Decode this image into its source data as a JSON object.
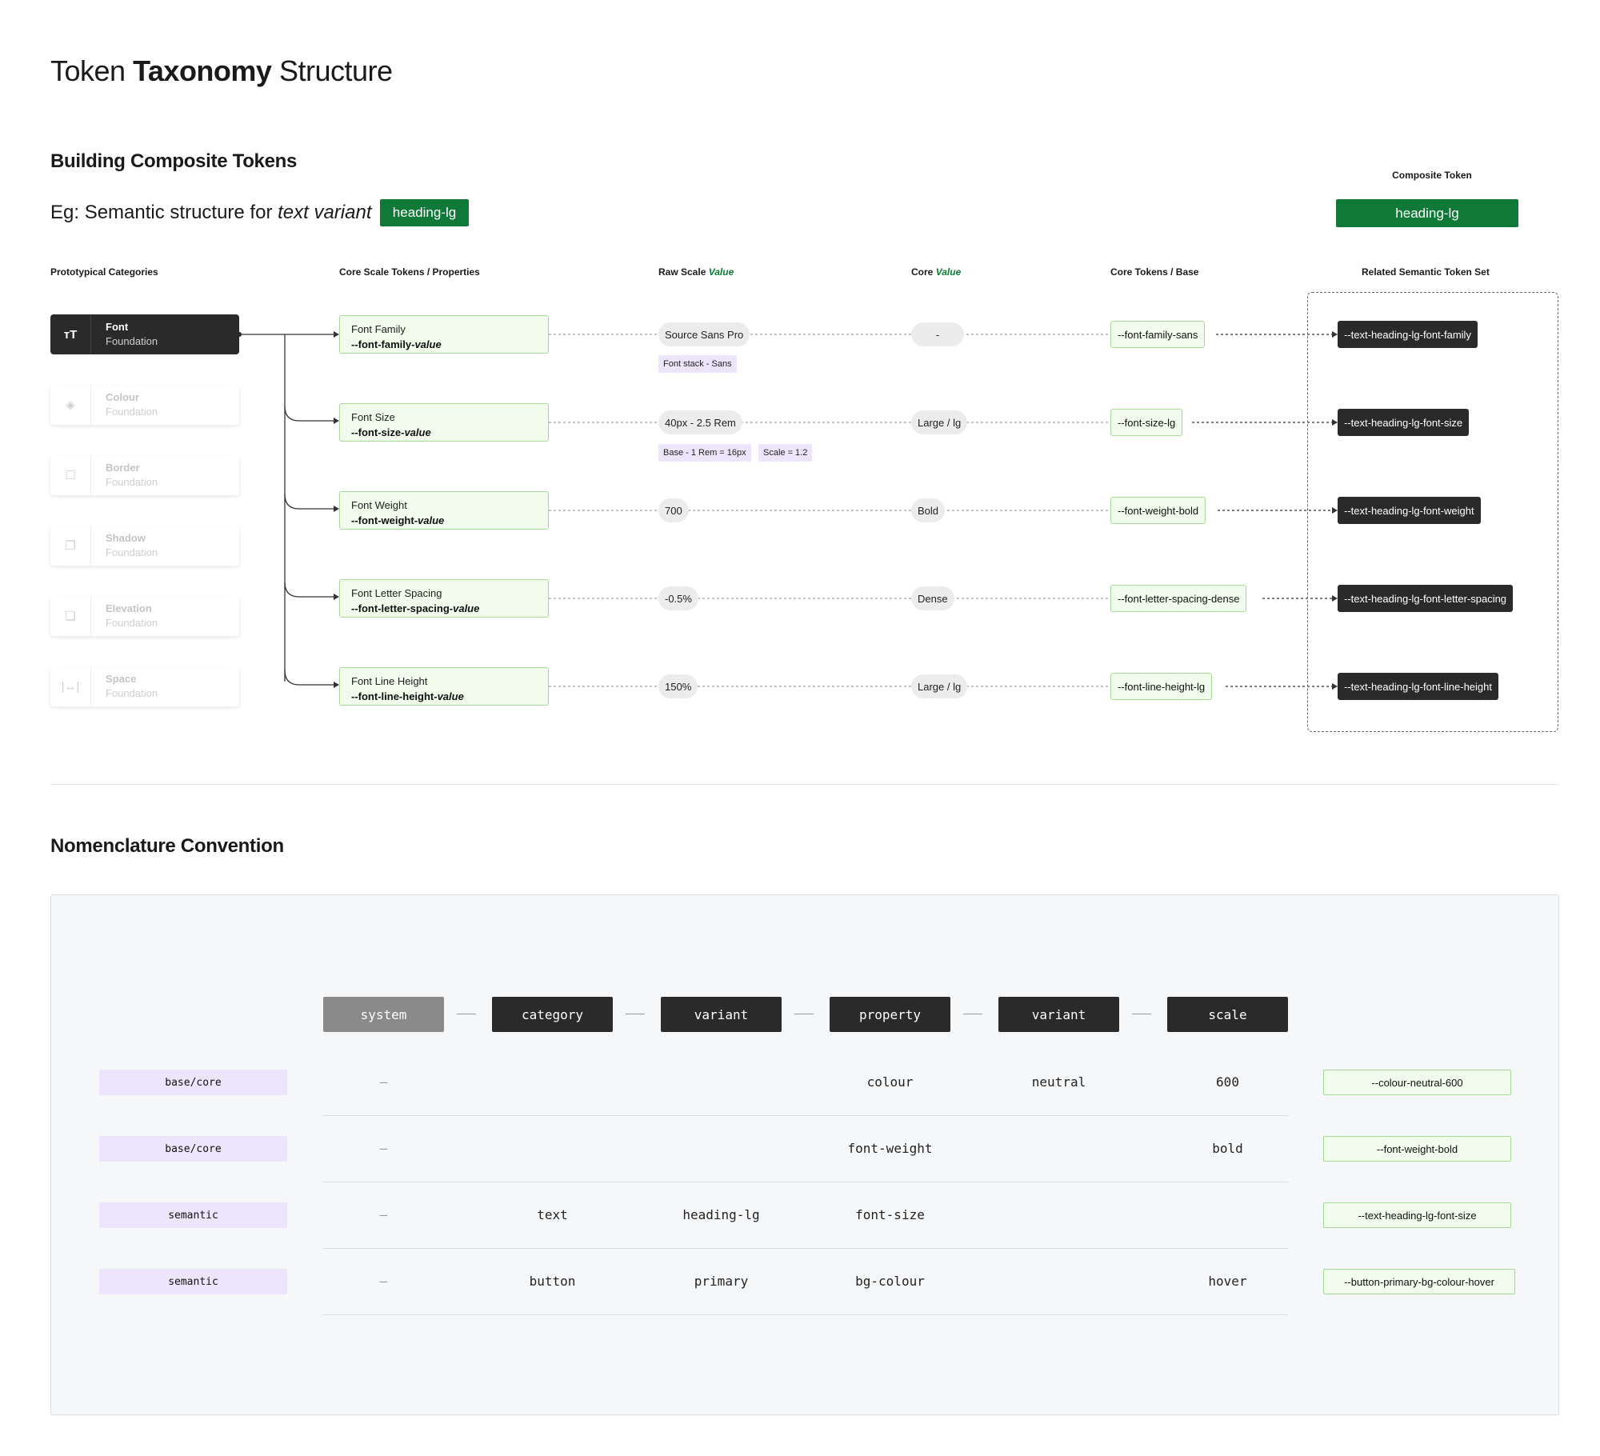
{
  "header": {
    "title_a": "Token ",
    "title_b": "Taxonomy",
    "title_c": " Structure"
  },
  "section1": {
    "title": "Building Composite Tokens",
    "example_prefix": "Eg: Semantic structure for ",
    "example_italic": "text variant",
    "example_tag": "heading-lg",
    "composite_label": "Composite Token",
    "composite_tag": "heading-lg"
  },
  "columns": {
    "categories": "Prototypical Categories",
    "core_scale": "Core Scale Tokens / Properties",
    "raw_a": "Raw Scale ",
    "raw_b": "Value",
    "core_a": "Core ",
    "core_b": "Value",
    "base": "Core Tokens / Base",
    "related": "Related Semantic Token Set"
  },
  "categories": [
    {
      "name": "Font",
      "sub": "Foundation",
      "icon": "text-size-icon",
      "glyph": "тT"
    },
    {
      "name": "Colour",
      "sub": "Foundation",
      "icon": "paint-bucket-icon",
      "glyph": "◈"
    },
    {
      "name": "Border",
      "sub": "Foundation",
      "icon": "square-outline-icon",
      "glyph": "☐"
    },
    {
      "name": "Shadow",
      "sub": "Foundation",
      "icon": "shadow-icon",
      "glyph": "❐"
    },
    {
      "name": "Elevation",
      "sub": "Foundation",
      "icon": "layers-icon",
      "glyph": "❏"
    },
    {
      "name": "Space",
      "sub": "Foundation",
      "icon": "spacing-icon",
      "glyph": "|↔|"
    }
  ],
  "rows": [
    {
      "label": "Font Family",
      "token_a": "--font-family-",
      "token_b": "value",
      "raw": "Source Sans Pro",
      "core": "-",
      "base": "--font-family-sans",
      "semantic": "--text-heading-lg-font-family",
      "notes": [
        "Font stack - Sans"
      ]
    },
    {
      "label": "Font Size",
      "token_a": "--font-size-",
      "token_b": "value",
      "raw": "40px - 2.5 Rem",
      "core": "Large / lg",
      "base": "--font-size-lg",
      "semantic": "--text-heading-lg-font-size",
      "notes": [
        "Base - 1 Rem = 16px",
        "Scale = 1.2"
      ]
    },
    {
      "label": "Font Weight",
      "token_a": "--font-weight-",
      "token_b": "value",
      "raw": "700",
      "core": "Bold",
      "base": "--font-weight-bold",
      "semantic": "--text-heading-lg-font-weight",
      "notes": []
    },
    {
      "label": "Font Letter Spacing",
      "token_a": "--font-letter-spacing-",
      "token_b": "value",
      "raw": "-0.5%",
      "core": "Dense",
      "base": "--font-letter-spacing-dense",
      "semantic": "--text-heading-lg-font-letter-spacing",
      "notes": []
    },
    {
      "label": "Font Line Height",
      "token_a": "--font-line-height-",
      "token_b": "value",
      "raw": "150%",
      "core": "Large / lg",
      "base": "--font-line-height-lg",
      "semantic": "--text-heading-lg-font-line-height",
      "notes": []
    }
  ],
  "section2": {
    "title": "Nomenclature Convention",
    "segments": [
      "system",
      "category",
      "variant",
      "property",
      "variant",
      "scale"
    ],
    "rows": [
      {
        "tag": "base/core",
        "cells": [
          "–",
          "",
          "",
          "colour",
          "neutral",
          "600"
        ],
        "result": "--colour-neutral-600"
      },
      {
        "tag": "base/core",
        "cells": [
          "–",
          "",
          "",
          "font-weight",
          "",
          "bold"
        ],
        "result": "--font-weight-bold"
      },
      {
        "tag": "semantic",
        "cells": [
          "–",
          "text",
          "heading-lg",
          "font-size",
          "",
          ""
        ],
        "result": "--text-heading-lg-font-size"
      },
      {
        "tag": "semantic",
        "cells": [
          "–",
          "button",
          "primary",
          "bg-colour",
          "",
          "hover"
        ],
        "result": "--button-primary-bg-colour-hover"
      }
    ]
  },
  "colors": {
    "brand_green": "#0f7a38",
    "dark": "#2a2a2a",
    "mint": "#f1fbeb",
    "lavender": "#ece5fb"
  }
}
